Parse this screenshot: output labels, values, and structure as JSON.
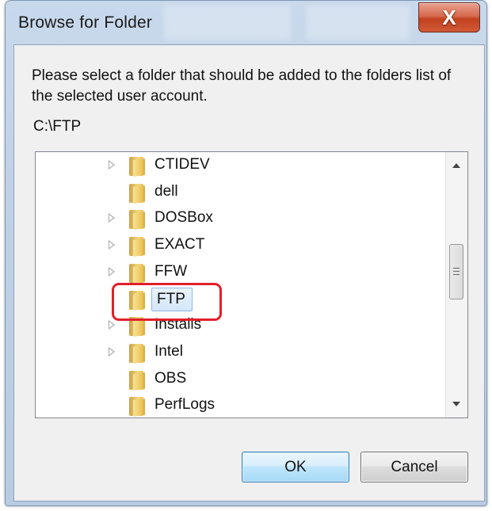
{
  "window": {
    "title": "Browse for Folder",
    "close_label": "X"
  },
  "dialog": {
    "instructions": "Please select a folder that should be added to the folders list of the selected user account.",
    "current_path": "C:\\FTP"
  },
  "tree": {
    "items": [
      {
        "label": "CTIDEV",
        "expandable": true,
        "selected": false
      },
      {
        "label": "dell",
        "expandable": false,
        "selected": false
      },
      {
        "label": "DOSBox",
        "expandable": true,
        "selected": false
      },
      {
        "label": "EXACT",
        "expandable": true,
        "selected": false
      },
      {
        "label": "FFW",
        "expandable": true,
        "selected": false
      },
      {
        "label": "FTP",
        "expandable": false,
        "selected": true
      },
      {
        "label": "Installs",
        "expandable": true,
        "selected": false
      },
      {
        "label": "Intel",
        "expandable": true,
        "selected": false
      },
      {
        "label": "OBS",
        "expandable": false,
        "selected": false
      },
      {
        "label": "PerfLogs",
        "expandable": false,
        "selected": false
      }
    ],
    "highlight_color": "#e0202a",
    "selection_color": "#d3e6f8"
  },
  "buttons": {
    "ok_label": "OK",
    "cancel_label": "Cancel"
  },
  "colors": {
    "close_button": "#c2421f",
    "window_frame": "#bfd1e7",
    "folder_icon": "#ecc65a"
  }
}
